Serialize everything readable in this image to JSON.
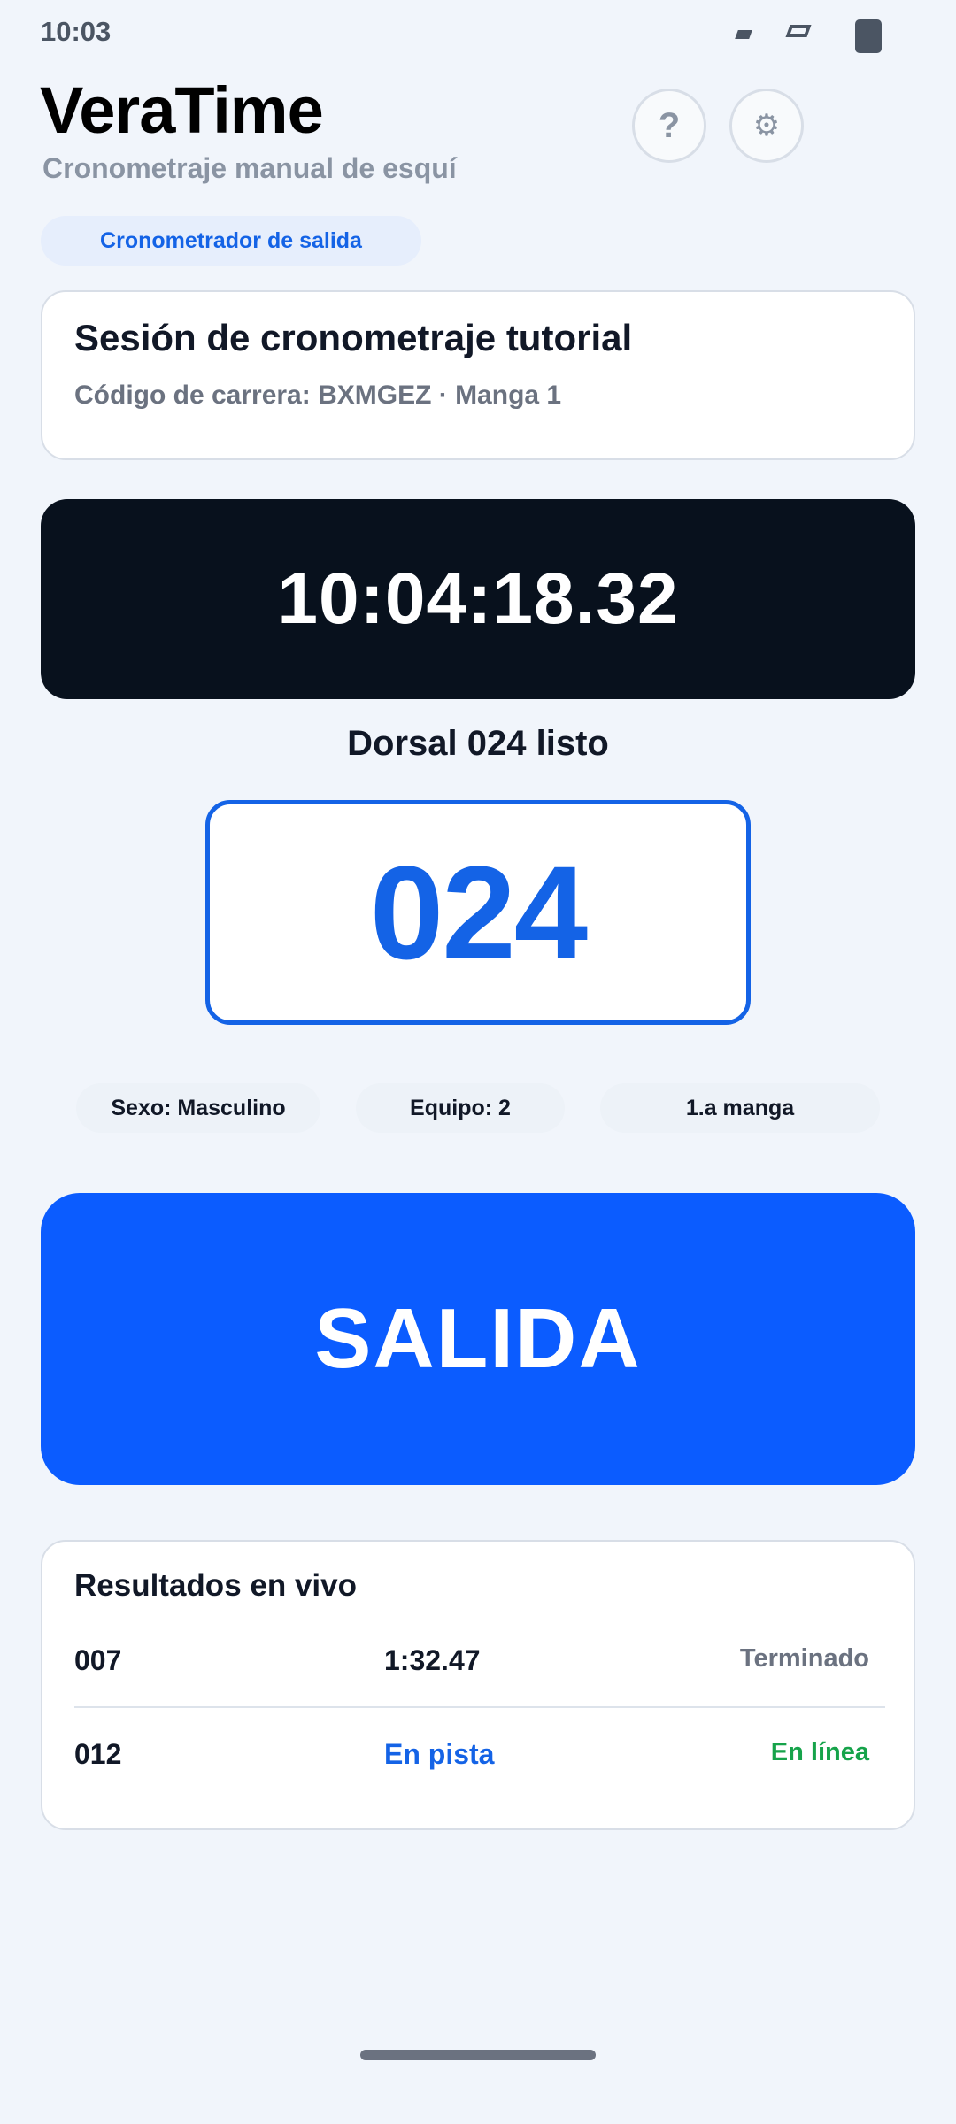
{
  "status_bar": {
    "time": "10:03"
  },
  "header": {
    "title": "VeraTime",
    "subtitle": "Cronometraje manual de esquí",
    "help_label": "?",
    "settings_icon": "⚙"
  },
  "role": {
    "label": "Cronometrador de salida"
  },
  "session": {
    "title": "Sesión de cronometraje tutorial",
    "meta": "Código de carrera: BXMGEZ · Manga 1"
  },
  "clock": {
    "value": "10:04:18.32"
  },
  "bib": {
    "status": "Dorsal 024 listo",
    "number": "024"
  },
  "info_pills": {
    "sex": "Sexo: Masculino",
    "team": "Equipo: 2",
    "run": "1.a manga"
  },
  "start_button": {
    "label": "SALIDA"
  },
  "results": {
    "title": "Resultados en vivo",
    "rows": [
      {
        "bib": "007",
        "time": "1:32.47",
        "state": "Terminado"
      },
      {
        "bib": "012",
        "time": "En pista",
        "state": "En línea"
      }
    ]
  },
  "colors": {
    "accent": "#0b5cff",
    "clock_bg": "#08111d",
    "online": "#16a34a",
    "background": "#f1f5fb"
  }
}
